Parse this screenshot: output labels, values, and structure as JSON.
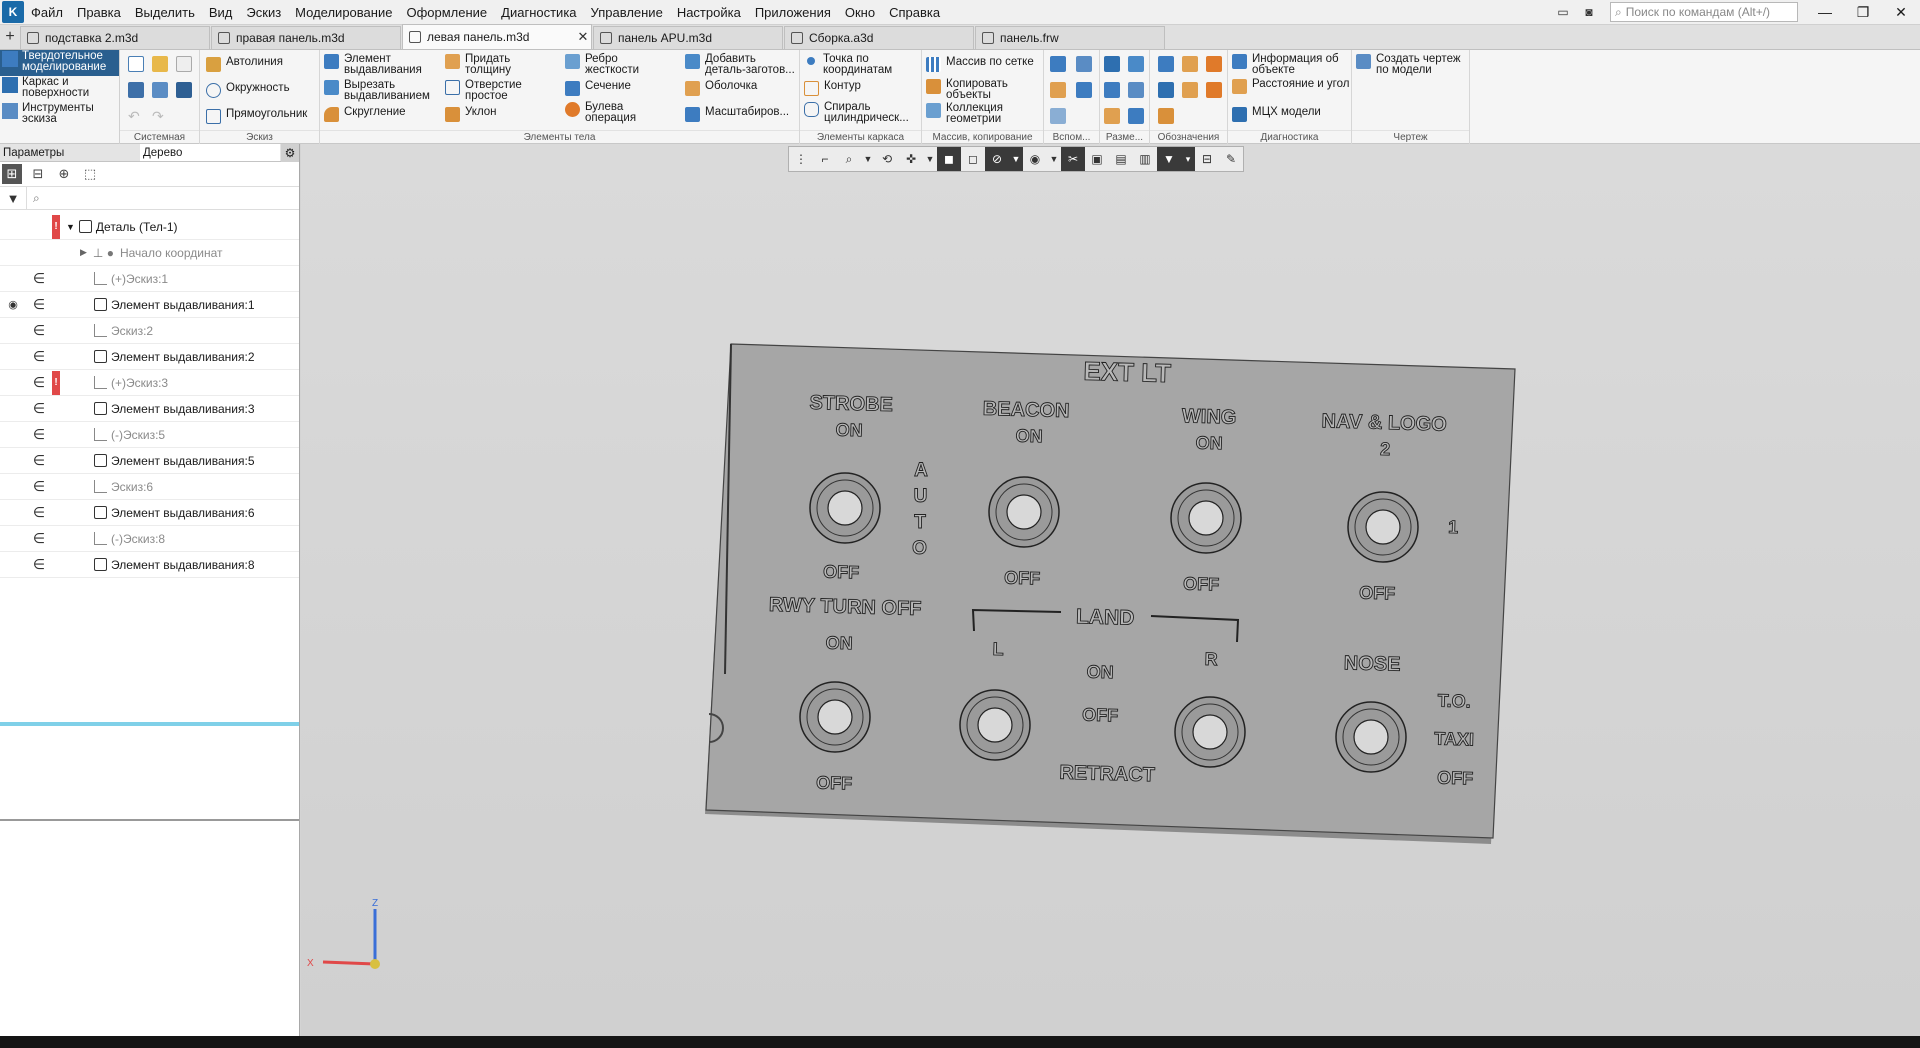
{
  "menu": [
    "Файл",
    "Правка",
    "Выделить",
    "Вид",
    "Эскиз",
    "Моделирование",
    "Оформление",
    "Диагностика",
    "Управление",
    "Настройка",
    "Приложения",
    "Окно",
    "Справка"
  ],
  "search_placeholder": "Поиск по командам (Alt+/)",
  "tabs": [
    {
      "label": "подставка 2.m3d",
      "active": false,
      "close": ""
    },
    {
      "label": "правая панель.m3d",
      "active": false,
      "close": ""
    },
    {
      "label": "левая панель.m3d",
      "active": true,
      "close": "✕"
    },
    {
      "label": "панель APU.m3d",
      "active": false,
      "close": ""
    },
    {
      "label": "Сборка.a3d",
      "active": false,
      "close": ""
    },
    {
      "label": "панель.frw",
      "active": false,
      "close": ""
    }
  ],
  "modes": [
    {
      "label": "Твердотельное моделирование",
      "active": true
    },
    {
      "label": "Каркас и поверхности",
      "active": false
    },
    {
      "label": "Инструменты эскиза",
      "active": false
    }
  ],
  "ribbon": {
    "groups": {
      "system": "Системная",
      "sketch": "Эскиз",
      "body": "Элементы тела",
      "frame": "Элементы каркаса",
      "array": "Массив, копирование",
      "aux": "Вспом...",
      "size": "Разме...",
      "notation": "Обозначения",
      "diag": "Диагностика",
      "drawing": "Чертеж"
    },
    "sketch_cmds": [
      "Автолиния",
      "Окружность",
      "Прямоугольник"
    ],
    "body_cmds": [
      "Элемент выдавливания",
      "Вырезать выдавливанием",
      "Скругление",
      "Придать толщину",
      "Отверстие простое",
      "Уклон",
      "Ребро жесткости",
      "Сечение",
      "Булева операция",
      "Добавить деталь-заготов...",
      "Оболочка",
      "Масштабиров..."
    ],
    "frame_cmds": [
      "Точка по координатам",
      "Контур",
      "Спираль цилиндрическ..."
    ],
    "array_cmds": [
      "Массив по сетке",
      "Копировать объекты",
      "Коллекция геометрии"
    ],
    "diag_cmds": [
      "Информация об объекте",
      "Расстояние и угол",
      "МЦХ модели"
    ],
    "drawing_cmds": [
      "Создать чертеж по модели"
    ]
  },
  "panel": {
    "tab_params": "Параметры",
    "tab_tree": "Дерево",
    "search_icon": "⌕"
  },
  "tree": [
    {
      "label": "Деталь (Тел-1)",
      "type": "root",
      "dim": false,
      "error": true,
      "visible": false
    },
    {
      "label": "Начало координат",
      "type": "origin",
      "dim": true,
      "error": false,
      "visible": false
    },
    {
      "label": "(+)Эскиз:1",
      "type": "sketch",
      "dim": true,
      "error": false,
      "visible": false
    },
    {
      "label": "Элемент выдавливания:1",
      "type": "extrude",
      "dim": false,
      "error": false,
      "visible": true
    },
    {
      "label": "Эскиз:2",
      "type": "sketch",
      "dim": true,
      "error": false,
      "visible": false
    },
    {
      "label": "Элемент выдавливания:2",
      "type": "extrude",
      "dim": false,
      "error": false,
      "visible": false
    },
    {
      "label": "(+)Эскиз:3",
      "type": "sketch",
      "dim": true,
      "error": true,
      "visible": false
    },
    {
      "label": "Элемент выдавливания:3",
      "type": "extrude",
      "dim": false,
      "error": false,
      "visible": false
    },
    {
      "label": "(-)Эскиз:5",
      "type": "sketch",
      "dim": true,
      "error": false,
      "visible": false
    },
    {
      "label": "Элемент выдавливания:5",
      "type": "extrude",
      "dim": false,
      "error": false,
      "visible": false
    },
    {
      "label": "Эскиз:6",
      "type": "sketch",
      "dim": true,
      "error": false,
      "visible": false
    },
    {
      "label": "Элемент выдавливания:6",
      "type": "extrude",
      "dim": false,
      "error": false,
      "visible": false
    },
    {
      "label": "(-)Эскиз:8",
      "type": "sketch",
      "dim": true,
      "error": false,
      "visible": false
    },
    {
      "label": "Элемент выдавливания:8",
      "type": "extrude",
      "dim": false,
      "error": false,
      "visible": false
    }
  ],
  "model_labels": {
    "title": "EXT LT",
    "strobe": "STROBE",
    "beacon": "BEACON",
    "wing": "WING",
    "nav_logo": "NAV  &  LOGO",
    "two": "2",
    "one": "1",
    "on": "ON",
    "off": "OFF",
    "auto": "AUTO",
    "rwy": "RWY TURN OFF",
    "land": "LAND",
    "l": "L",
    "r": "R",
    "retract": "RETRACT",
    "nose": "NOSE",
    "to": "T.O.",
    "taxi": "TAXI"
  },
  "triad": {
    "x": "X",
    "z": "Z"
  },
  "colors": {
    "accent": "#2a5f8f",
    "panel_face": "#a6a6a6",
    "error": "#e04848"
  }
}
